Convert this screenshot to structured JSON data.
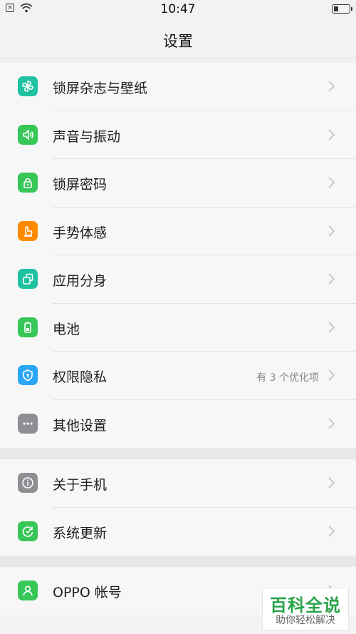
{
  "status_bar": {
    "time": "10:47"
  },
  "header": {
    "title": "设置"
  },
  "sections": [
    {
      "items": [
        {
          "label": "锁屏杂志与壁纸",
          "icon": "pinwheel-icon",
          "color": "#1ec2a0"
        },
        {
          "label": "声音与振动",
          "icon": "speaker-icon",
          "color": "#37c759"
        },
        {
          "label": "锁屏密码",
          "icon": "lock-icon",
          "color": "#37c759"
        },
        {
          "label": "手势体感",
          "icon": "hand-icon",
          "color": "#ff8a00"
        },
        {
          "label": "应用分身",
          "icon": "app-clone-icon",
          "color": "#1ec2a0"
        },
        {
          "label": "电池",
          "icon": "battery-icon",
          "color": "#37c759"
        },
        {
          "label": "权限隐私",
          "icon": "shield-icon",
          "color": "#2aa6f5",
          "hint": "有 3 个优化项"
        },
        {
          "label": "其他设置",
          "icon": "more-icon",
          "color": "#8e8e93"
        }
      ]
    },
    {
      "items": [
        {
          "label": "关于手机",
          "icon": "info-icon",
          "color": "#8e8e93"
        },
        {
          "label": "系统更新",
          "icon": "update-icon",
          "color": "#37c759"
        }
      ]
    },
    {
      "items": [
        {
          "label": "OPPO 帐号",
          "icon": "account-icon",
          "color": "#37c759"
        }
      ]
    }
  ],
  "watermark": {
    "title": "百科全说",
    "subtitle": "助你轻松解决"
  }
}
